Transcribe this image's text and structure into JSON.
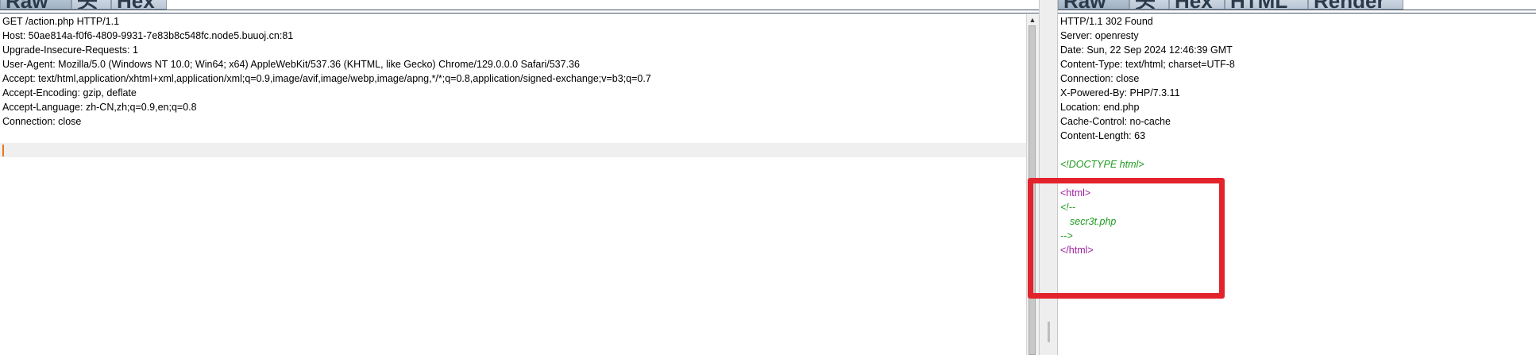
{
  "request_panel": {
    "tabs": [
      "Raw",
      "头",
      "Hex"
    ],
    "lines": [
      "GET /action.php HTTP/1.1",
      "Host: 50ae814a-f0f6-4809-9931-7e83b8c548fc.node5.buuoj.cn:81",
      "Upgrade-Insecure-Requests: 1",
      "User-Agent: Mozilla/5.0 (Windows NT 10.0; Win64; x64) AppleWebKit/537.36 (KHTML, like Gecko) Chrome/129.0.0.0 Safari/537.36",
      "Accept: text/html,application/xhtml+xml,application/xml;q=0.9,image/avif,image/webp,image/apng,*/*;q=0.8,application/signed-exchange;v=b3;q=0.7",
      "Accept-Encoding: gzip, deflate",
      "Accept-Language: zh-CN,zh;q=0.9,en;q=0.8",
      "Connection: close",
      "",
      ""
    ]
  },
  "response_panel": {
    "tabs": [
      "Raw",
      "头",
      "Hex",
      "HTML",
      "Render"
    ],
    "header_lines": [
      "HTTP/1.1 302 Found",
      "Server: openresty",
      "Date: Sun, 22 Sep 2024 12:46:39 GMT",
      "Content-Type: text/html; charset=UTF-8",
      "Connection: close",
      "X-Powered-By: PHP/7.3.11",
      "Location: end.php",
      "Cache-Control: no-cache",
      "Content-Length: 63"
    ],
    "body": {
      "doctype": "<!DOCTYPE html>",
      "html_open": "<html>",
      "comment_open": "<!--",
      "comment_text": "secr3t.php",
      "comment_close": "-->",
      "html_close": "</html>"
    }
  },
  "colors": {
    "tag": "#9a1d9a",
    "comment": "#1f9a1f",
    "annotation": "#e3232c",
    "caret": "#e8731a"
  }
}
